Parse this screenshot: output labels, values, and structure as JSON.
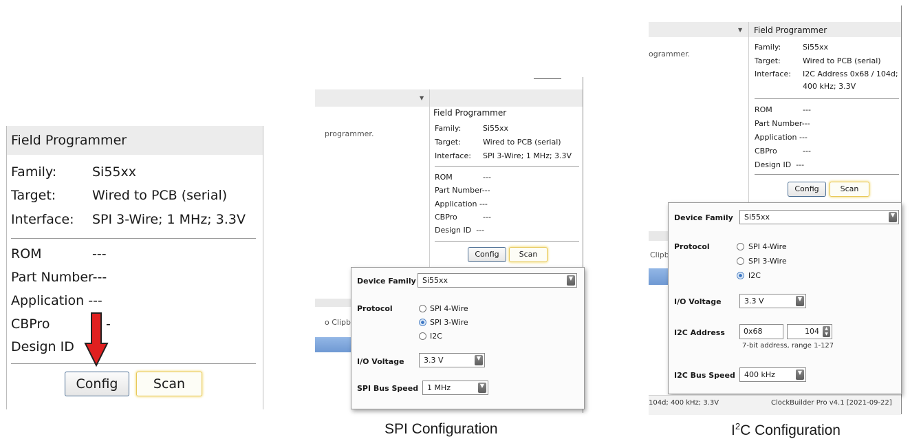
{
  "panel1": {
    "header": "Field Programmer",
    "family_label": "Family:",
    "family_value": "Si55xx",
    "target_label": "Target:",
    "target_value": "Wired to PCB (serial)",
    "interface_label": "Interface:",
    "interface_value": "SPI 3-Wire; 1 MHz; 3.3V",
    "rom_label": "ROM",
    "rom_value": "---",
    "part_label": "Part Number",
    "part_value": "---",
    "app_label": "Application",
    "app_value": "---",
    "cbpro_label": "CBPro",
    "cbpro_value": "-",
    "design_label": "Design ID",
    "config_btn": "Config",
    "scan_btn": "Scan",
    "arrow_color": "#e02020"
  },
  "panel2": {
    "bg_text": "programmer.",
    "bg_text2": "o Clipb",
    "header": "Field Programmer",
    "family_label": "Family:",
    "family_value": "Si55xx",
    "target_label": "Target:",
    "target_value": "Wired to PCB (serial)",
    "interface_label": "Interface:",
    "interface_value": "SPI 3-Wire; 1 MHz; 3.3V",
    "rom_label": "ROM",
    "rom_value": "---",
    "part_label": "Part Number",
    "part_value": "---",
    "app_label": "Application",
    "app_value": "---",
    "cbpro_label": "CBPro",
    "cbpro_value": "---",
    "design_label": "Design ID",
    "design_value": "---",
    "config_btn": "Config",
    "scan_btn": "Scan",
    "dialog": {
      "device_family_label": "Device Family",
      "device_family_value": "Si55xx",
      "protocol_label": "Protocol",
      "protocol_options": [
        "SPI 4-Wire",
        "SPI 3-Wire",
        "I2C"
      ],
      "protocol_selected": "SPI 3-Wire",
      "io_voltage_label": "I/O Voltage",
      "io_voltage_value": "3.3 V",
      "spi_speed_label": "SPI Bus Speed",
      "spi_speed_value": "1 MHz"
    },
    "caption": "SPI Configuration"
  },
  "panel3": {
    "bg_text": "ogrammer.",
    "bg_text2": "Clipb",
    "header": "Field Programmer",
    "family_label": "Family:",
    "family_value": "Si55xx",
    "target_label": "Target:",
    "target_value": "Wired to PCB (serial)",
    "interface_label": "Interface:",
    "interface_value_line1": "I2C Address 0x68 / 104d;",
    "interface_value_line2": "400 kHz; 3.3V",
    "rom_label": "ROM",
    "rom_value": "---",
    "part_label": "Part Number",
    "part_value": "---",
    "app_label": "Application",
    "app_value": "---",
    "cbpro_label": "CBPro",
    "cbpro_value": "---",
    "design_label": "Design ID",
    "design_value": "---",
    "config_btn": "Config",
    "scan_btn": "Scan",
    "dialog": {
      "device_family_label": "Device Family",
      "device_family_value": "Si55xx",
      "protocol_label": "Protocol",
      "protocol_options": [
        "SPI 4-Wire",
        "SPI 3-Wire",
        "I2C"
      ],
      "protocol_selected": "I2C",
      "io_voltage_label": "I/O Voltage",
      "io_voltage_value": "3.3 V",
      "i2c_address_label": "I2C Address",
      "i2c_hex_value": "0x68",
      "i2c_dec_value": "104",
      "i2c_hint": "7-bit address, range 1-127",
      "i2c_speed_label": "I2C Bus Speed",
      "i2c_speed_value": "400 kHz"
    },
    "status_left": "104d; 400 kHz; 3.3V",
    "status_right": "ClockBuilder Pro v4.1 [2021-09-22]",
    "caption_prefix": "I",
    "caption_sup": "2",
    "caption_rest": "C Configuration"
  }
}
